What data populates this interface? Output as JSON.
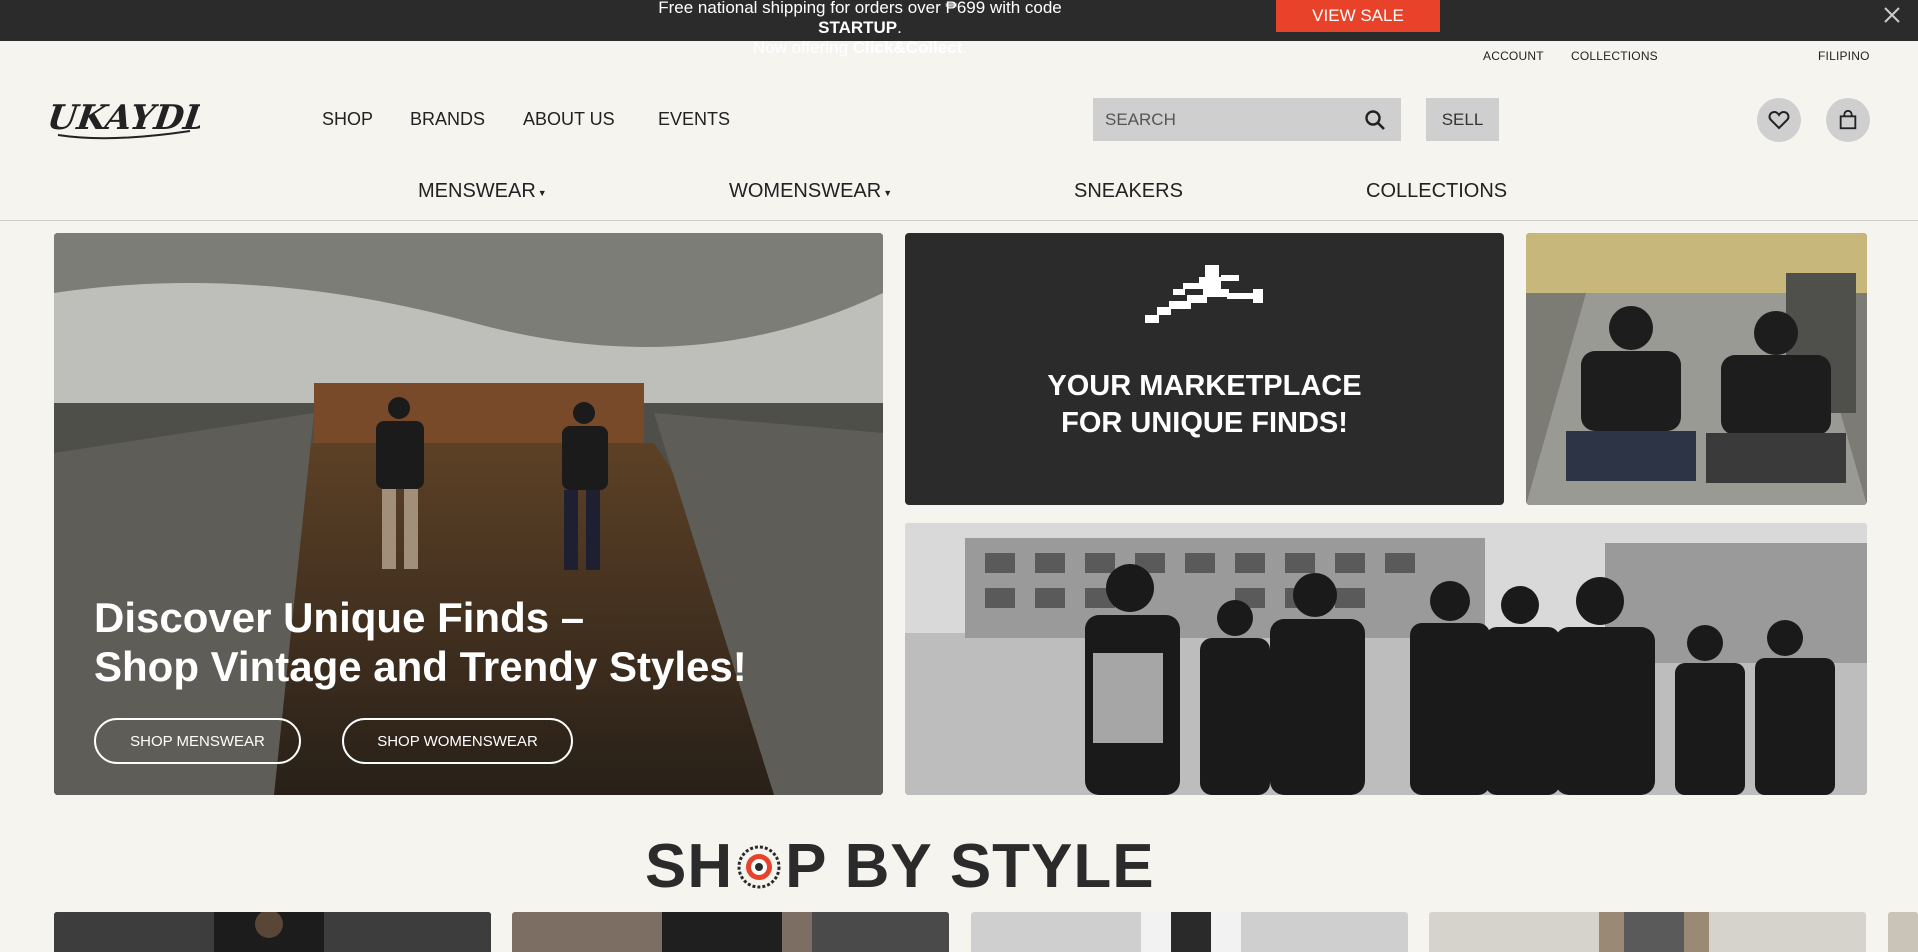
{
  "promo": {
    "line1_prefix": "Free national shipping for orders over ₱699 with code ",
    "code": "STARTUP",
    "line1_suffix": ".",
    "line2_prefix": "Now offering ",
    "click_collect": "Click&Collect",
    "line2_suffix": ".",
    "cta": "VIEW SALE"
  },
  "utility": {
    "account": "ACCOUNT",
    "collections": "COLLECTIONS",
    "language": "FILIPINO"
  },
  "logo_text": "UKAYDD",
  "main_nav": [
    "SHOP",
    "BRANDS",
    "ABOUT US",
    "EVENTS"
  ],
  "search": {
    "placeholder": "SEARCH"
  },
  "sell": "SELL",
  "categories": [
    "MENSWEAR",
    "WOMENSWEAR",
    "SNEAKERS",
    "COLLECTIONS"
  ],
  "hero": {
    "headline_line1": "Discover Unique Finds –",
    "headline_line2": "Shop Vintage and Trendy Styles!",
    "btn_men": "SHOP MENSWEAR",
    "btn_women": "SHOP WOMENSWEAR"
  },
  "tagline": {
    "line1": "YOUR MARKETPLACE",
    "line2": "FOR UNIQUE FINDS!"
  },
  "shop_by_style": {
    "part1": "SH",
    "part2": "P BY STYLE"
  },
  "colors": {
    "accent": "#e8432a",
    "dark": "#2b2b2b",
    "background": "#f6f4ef",
    "button_grey": "#cfcfcf"
  }
}
